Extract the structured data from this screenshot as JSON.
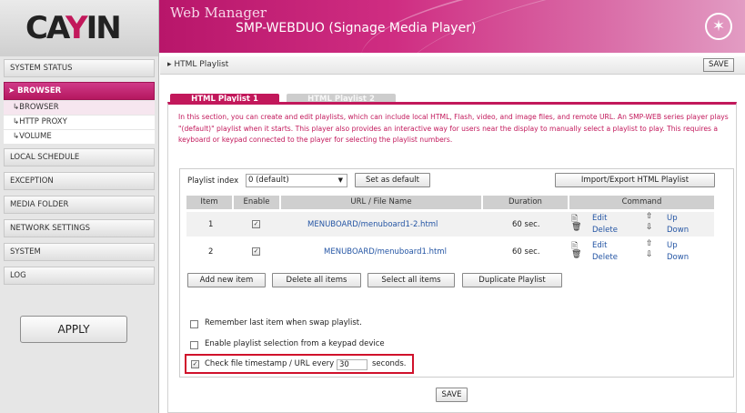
{
  "brand": {
    "logo": "CAYIN"
  },
  "banner": {
    "line1": "Web Manager",
    "line2": "SMP-WEBDUO (Signage Media Player)"
  },
  "sidebar": {
    "items": [
      {
        "label": "SYSTEM STATUS"
      },
      {
        "label": "BROWSER"
      },
      {
        "label": "LOCAL SCHEDULE"
      },
      {
        "label": "EXCEPTION"
      },
      {
        "label": "MEDIA FOLDER"
      },
      {
        "label": "NETWORK SETTINGS"
      },
      {
        "label": "SYSTEM"
      },
      {
        "label": "LOG"
      }
    ],
    "subitems": [
      {
        "label": "BROWSER"
      },
      {
        "label": "HTTP PROXY"
      },
      {
        "label": "VOLUME"
      }
    ],
    "apply_label": "APPLY"
  },
  "header": {
    "breadcrumb": "HTML Playlist",
    "save_label": "SAVE"
  },
  "tabs": [
    {
      "label": "HTML Playlist 1"
    },
    {
      "label": "HTML Playlist 2"
    }
  ],
  "description": "In this section, you can create and edit playlists, which can include local HTML, Flash, video, and image files, and remote URL. An SMP-WEB series player plays \"(default)\" playlist when it starts. This player also provides an interactive way for users near the display to manually select a playlist to play. This requires a keyboard or keypad connected to the player for selecting the playlist numbers.",
  "playlist": {
    "index_label": "Playlist index",
    "index_value": "0 (default)",
    "set_default_label": "Set as default",
    "import_export_label": "Import/Export HTML Playlist",
    "columns": [
      "Item",
      "Enable",
      "URL / File Name",
      "Duration",
      "Command"
    ],
    "rows": [
      {
        "item": "1",
        "url": "MENUBOARD/menuboard1-2.html",
        "duration": "60 sec.",
        "edit": "Edit",
        "delete": "Delete",
        "up": "Up",
        "down": "Down"
      },
      {
        "item": "2",
        "url": "MENUBOARD/menuboard1.html",
        "duration": "60 sec.",
        "edit": "Edit",
        "delete": "Delete",
        "up": "Up",
        "down": "Down"
      }
    ],
    "add_label": "Add new item",
    "delete_all_label": "Delete all items",
    "select_all_label": "Select all items",
    "duplicate_label": "Duplicate Playlist"
  },
  "options": {
    "remember_label": "Remember last item when swap playlist.",
    "keypad_label": "Enable playlist selection from a keypad device",
    "timestamp_label": "Check file timestamp / URL every",
    "timestamp_value": "30",
    "seconds_label": "seconds."
  },
  "footer": {
    "save_label": "SAVE"
  },
  "colors": {
    "accent": "#c2185b",
    "link": "#2455a4",
    "highlight": "#d0112b"
  }
}
